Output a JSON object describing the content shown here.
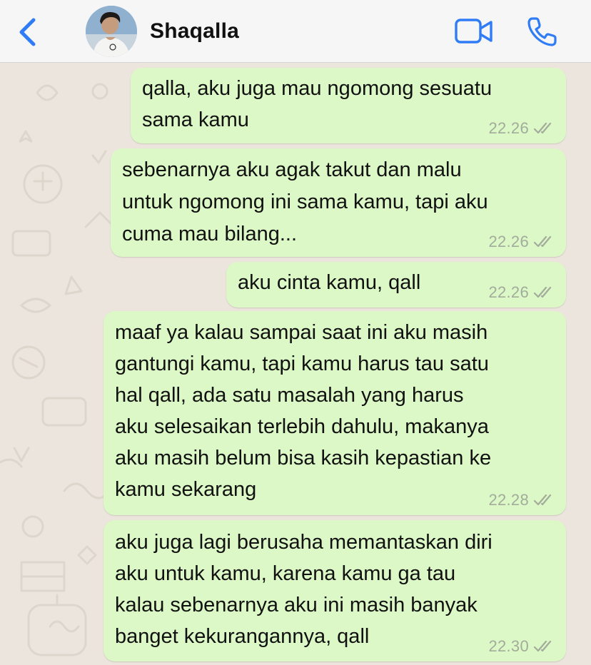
{
  "header": {
    "contact_name": "Shaqalla",
    "back_icon": "chevron-left-icon",
    "video_icon": "video-camera-icon",
    "call_icon": "phone-icon"
  },
  "colors": {
    "accent": "#2f7cf6",
    "outgoing_bubble": "#dcf8c6",
    "wallpaper": "#ece5dd",
    "timestamp": "#a3ac9c"
  },
  "messages": [
    {
      "lines": [
        "qalla, aku juga mau ngomong sesuatu",
        "sama kamu"
      ],
      "time": "22.26",
      "status": "read"
    },
    {
      "lines": [
        "sebenarnya aku agak takut dan malu",
        "untuk ngomong ini sama kamu, tapi aku",
        "cuma mau bilang..."
      ],
      "time": "22.26",
      "status": "read"
    },
    {
      "lines": [
        "aku cinta kamu, qall"
      ],
      "time": "22.26",
      "status": "read"
    },
    {
      "lines": [
        "maaf ya kalau sampai saat ini aku masih",
        "gantungi kamu, tapi kamu harus tau satu",
        "hal qall, ada satu masalah yang harus",
        "aku selesaikan terlebih dahulu, makanya",
        "aku masih belum bisa kasih kepastian ke",
        "kamu sekarang"
      ],
      "time": "22.28",
      "status": "read"
    },
    {
      "lines": [
        "aku juga lagi berusaha memantaskan diri",
        "aku untuk kamu, karena kamu ga tau",
        "kalau sebenarnya aku ini masih banyak",
        "banget kekurangannya, qall"
      ],
      "time": "22.30",
      "status": "read"
    }
  ]
}
